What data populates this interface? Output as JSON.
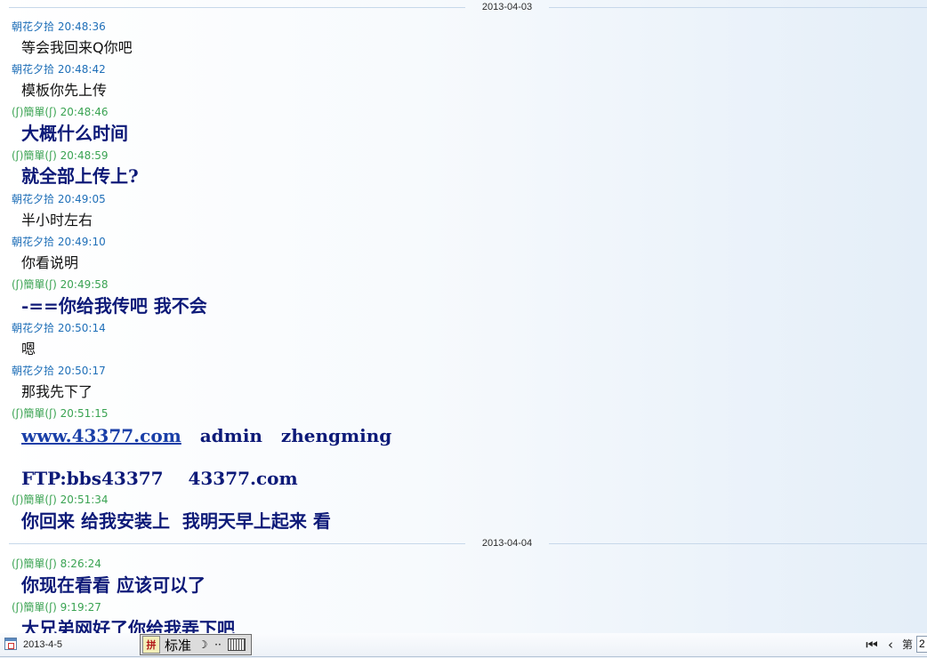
{
  "dates": {
    "first": "2013-04-03",
    "second": "2013-04-04"
  },
  "messages": [
    {
      "sender": "朝花夕拾",
      "time": "20:48:36",
      "text": "等会我回来Q你吧"
    },
    {
      "sender": "朝花夕拾",
      "time": "20:48:42",
      "text": "模板你先上传"
    },
    {
      "sender": "(ʃ)簡單(ʃ)",
      "time": "20:48:46",
      "text": "大概什么时间"
    },
    {
      "sender": "(ʃ)簡單(ʃ)",
      "time": "20:48:59",
      "text": "就全部上传上?"
    },
    {
      "sender": "朝花夕拾",
      "time": "20:49:05",
      "text": "半小时左右"
    },
    {
      "sender": "朝花夕拾",
      "time": "20:49:10",
      "text": "你看说明"
    },
    {
      "sender": "(ʃ)簡單(ʃ)",
      "time": "20:49:58",
      "text": "-==你给我传吧 我不会"
    },
    {
      "sender": "朝花夕拾",
      "time": "20:50:14",
      "text": "嗯"
    },
    {
      "sender": "朝花夕拾",
      "time": "20:50:17",
      "text": "那我先下了"
    },
    {
      "sender": "(ʃ)簡單(ʃ)",
      "time": "20:51:15",
      "link": "www.43377.com",
      "text_rest": "   admin   zhengming",
      "text_line2": "FTP:bbs43377    43377.com"
    },
    {
      "sender": "(ʃ)簡單(ʃ)",
      "time": "20:51:34",
      "text": "你回来 给我安装上  我明天早上起来 看"
    },
    {
      "sender": "(ʃ)簡單(ʃ)",
      "time": "8:26:24",
      "text": "你现在看看 应该可以了"
    },
    {
      "sender": "(ʃ)簡單(ʃ)",
      "time": "9:19:27",
      "text": "大兄弟网好了你给我弄下吧"
    }
  ],
  "bottom_bar": {
    "current_date": "2013-4-5",
    "ime_mode": "标准",
    "ime_punct": "☽",
    "ime_width": "··",
    "first_page_icon": "first-page-icon",
    "prev_page_icon": "prev-page-icon",
    "page_label": "第",
    "page_value": "2"
  },
  "colors": {
    "sender_self": "#1f6fb8",
    "sender_other": "#3aa352",
    "message_other": "#0d1a78",
    "link": "#1a3fa8"
  }
}
